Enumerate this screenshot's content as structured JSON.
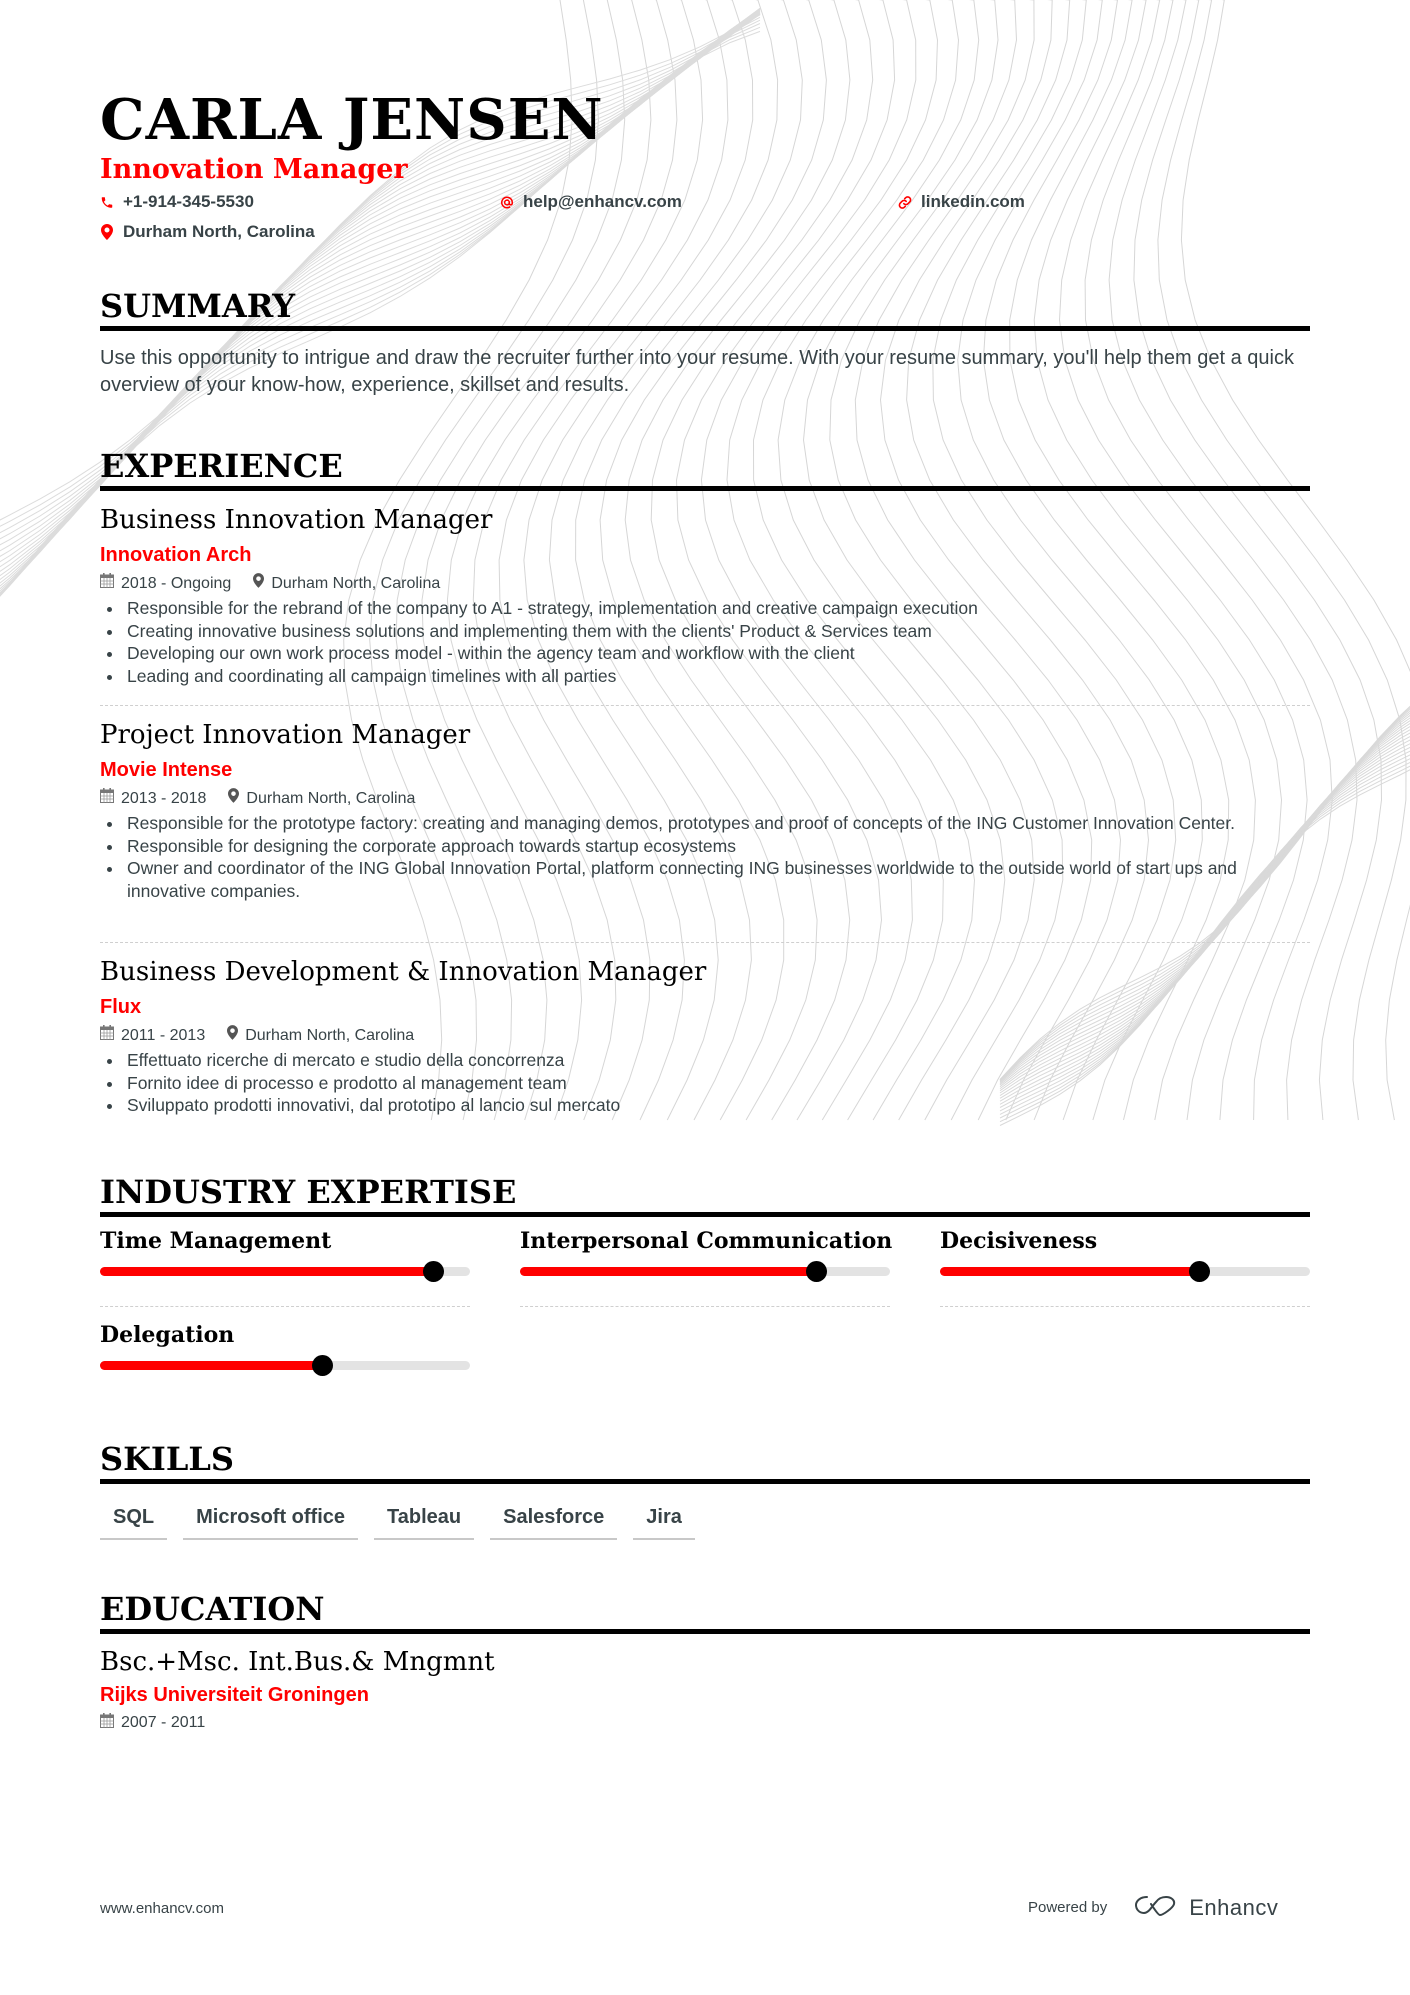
{
  "header": {
    "name": "CARLA JENSEN",
    "title": "Innovation Manager",
    "contacts": {
      "phone": "+1-914-345-5530",
      "email": "help@enhancv.com",
      "link": "linkedin.com",
      "location": "Durham North, Carolina"
    },
    "icons": {
      "phone": "phone-icon",
      "email": "at-icon",
      "link": "link-icon",
      "location": "map-pin-icon"
    }
  },
  "summary": {
    "heading": "SUMMARY",
    "text": "Use this opportunity to intrigue and draw the recruiter further into your resume. With your resume summary, you'll help them get a quick overview of your know-how, experience, skillset and results."
  },
  "experience": {
    "heading": "EXPERIENCE",
    "jobs": [
      {
        "title": "Business Innovation Manager",
        "company": "Innovation Arch",
        "dates": "2018 - Ongoing",
        "location": "Durham North, Carolina",
        "bullets": [
          "Responsible for the rebrand of the company to A1 - strategy, implementation and creative campaign execution",
          "Creating innovative business solutions and implementing  them with the clients' Product & Services team",
          "Developing our own work process model - within the agency team and workflow with the client",
          "Leading and coordinating all campaign timelines with all parties"
        ]
      },
      {
        "title": "Project Innovation Manager",
        "company": "Movie Intense",
        "dates": "2013 - 2018",
        "location": "Durham North, Carolina",
        "bullets": [
          "Responsible for the prototype factory: creating and managing demos, prototypes and proof of concepts of the ING Customer Innovation Center.",
          "Responsible for designing the corporate approach towards startup ecosystems",
          "Owner and coordinator of the ING Global Innovation Portal, platform connecting ING businesses worldwide to the outside world of start ups and innovative companies."
        ]
      },
      {
        "title": "Business Development & Innovation Manager",
        "company": "Flux",
        "dates": "2011 - 2013",
        "location": "Durham North, Carolina",
        "bullets": [
          "Effettuato ricerche di mercato e studio della concorrenza",
          "Fornito idee di processo e prodotto al management team",
          "Sviluppato prodotti innovativi, dal prototipo al lancio sul mercato"
        ]
      }
    ]
  },
  "expertise": {
    "heading": "INDUSTRY EXPERTISE",
    "items": [
      {
        "label": "Time Management",
        "level_percent": 90
      },
      {
        "label": "Interpersonal Communication",
        "level_percent": 80
      },
      {
        "label": "Decisiveness",
        "level_percent": 70
      },
      {
        "label": "Delegation",
        "level_percent": 60
      }
    ]
  },
  "skills": {
    "heading": "SKILLS",
    "items": [
      "SQL",
      "Microsoft office",
      "Tableau",
      "Salesforce",
      "Jira"
    ]
  },
  "education": {
    "heading": "EDUCATION",
    "degree": "Bsc.+Msc. Int.Bus.& Mngmnt",
    "school": "Rijks Universiteit Groningen",
    "dates": "2007 - 2011"
  },
  "footer": {
    "url": "www.enhancv.com",
    "powered_by": "Powered by",
    "brand": "Enhancv"
  },
  "colors": {
    "accent": "#ff0000",
    "text": "#384347",
    "heading": "#000000",
    "track": "#e3e3e3",
    "wave": "#d6d6d6"
  }
}
